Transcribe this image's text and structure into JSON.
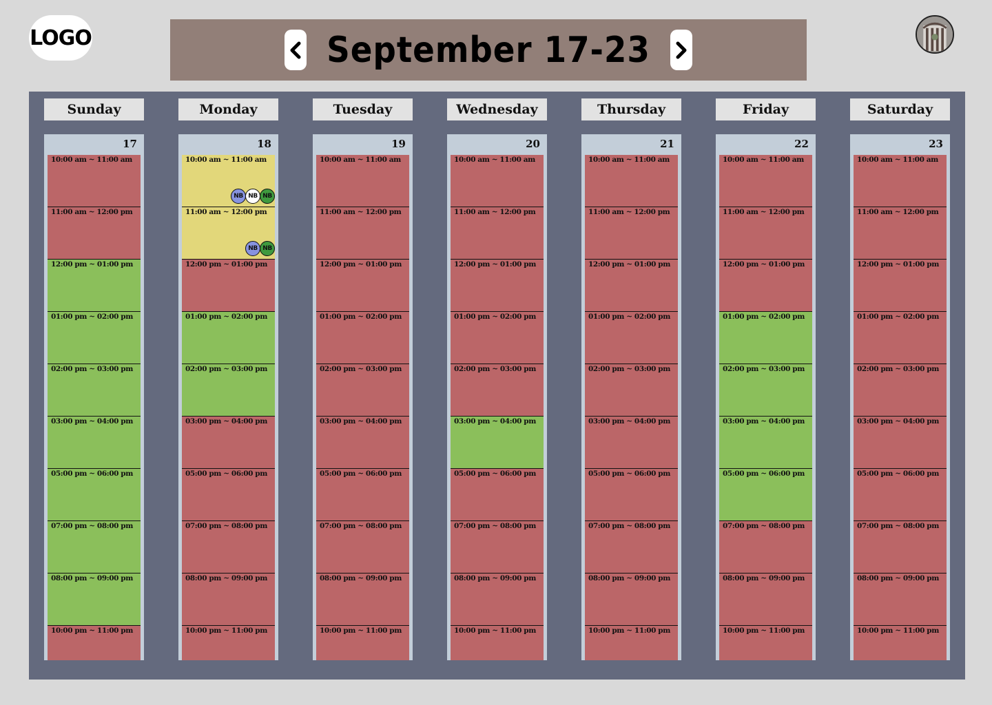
{
  "logo": {
    "text": "LOGO"
  },
  "header": {
    "title": "September 17-23",
    "prev_icon": "chevron-left-icon",
    "next_icon": "chevron-right-icon"
  },
  "avatar": {
    "icon": "user-avatar"
  },
  "colors": {
    "unavailable": "#bb6668",
    "available": "#8bbf5b",
    "booked": "#e2d77a",
    "board": "#646a7e",
    "header_bg": "#927f78"
  },
  "days": [
    {
      "name": "Sunday",
      "date": "17",
      "slots": [
        {
          "time": "10:00 am ~ 11:00 am",
          "status": "unavailable"
        },
        {
          "time": "11:00 am ~ 12:00 pm",
          "status": "unavailable"
        },
        {
          "time": "12:00 pm ~ 01:00 pm",
          "status": "available"
        },
        {
          "time": "01:00 pm ~ 02:00 pm",
          "status": "available"
        },
        {
          "time": "02:00 pm ~ 03:00 pm",
          "status": "available"
        },
        {
          "time": "03:00 pm ~ 04:00 pm",
          "status": "available"
        },
        {
          "time": "05:00 pm ~ 06:00 pm",
          "status": "available"
        },
        {
          "time": "07:00 pm ~ 08:00 pm",
          "status": "available"
        },
        {
          "time": "08:00 pm ~ 09:00 pm",
          "status": "available"
        },
        {
          "time": "10:00 pm ~ 11:00 pm",
          "status": "unavailable"
        }
      ]
    },
    {
      "name": "Monday",
      "date": "18",
      "slots": [
        {
          "time": "10:00 am ~ 11:00 am",
          "status": "booked",
          "badges": [
            {
              "label": "NB",
              "color": "#8793e0"
            },
            {
              "label": "NB",
              "color": "#ffffff"
            },
            {
              "label": "NB",
              "color": "#3f9a3e"
            }
          ]
        },
        {
          "time": "11:00 am ~ 12:00 pm",
          "status": "booked",
          "badges": [
            {
              "label": "NB",
              "color": "#8793e0"
            },
            {
              "label": "NB",
              "color": "#3f9a3e"
            }
          ]
        },
        {
          "time": "12:00 pm ~ 01:00 pm",
          "status": "unavailable"
        },
        {
          "time": "01:00 pm ~ 02:00 pm",
          "status": "available"
        },
        {
          "time": "02:00 pm ~ 03:00 pm",
          "status": "available"
        },
        {
          "time": "03:00 pm ~ 04:00 pm",
          "status": "unavailable"
        },
        {
          "time": "05:00 pm ~ 06:00 pm",
          "status": "unavailable"
        },
        {
          "time": "07:00 pm ~ 08:00 pm",
          "status": "unavailable"
        },
        {
          "time": "08:00 pm ~ 09:00 pm",
          "status": "unavailable"
        },
        {
          "time": "10:00 pm ~ 11:00 pm",
          "status": "unavailable"
        }
      ]
    },
    {
      "name": "Tuesday",
      "date": "19",
      "slots": [
        {
          "time": "10:00 am ~ 11:00 am",
          "status": "unavailable"
        },
        {
          "time": "11:00 am ~ 12:00 pm",
          "status": "unavailable"
        },
        {
          "time": "12:00 pm ~ 01:00 pm",
          "status": "unavailable"
        },
        {
          "time": "01:00 pm ~ 02:00 pm",
          "status": "unavailable"
        },
        {
          "time": "02:00 pm ~ 03:00 pm",
          "status": "unavailable"
        },
        {
          "time": "03:00 pm ~ 04:00 pm",
          "status": "unavailable"
        },
        {
          "time": "05:00 pm ~ 06:00 pm",
          "status": "unavailable"
        },
        {
          "time": "07:00 pm ~ 08:00 pm",
          "status": "unavailable"
        },
        {
          "time": "08:00 pm ~ 09:00 pm",
          "status": "unavailable"
        },
        {
          "time": "10:00 pm ~ 11:00 pm",
          "status": "unavailable"
        }
      ]
    },
    {
      "name": "Wednesday",
      "date": "20",
      "slots": [
        {
          "time": "10:00 am ~ 11:00 am",
          "status": "unavailable"
        },
        {
          "time": "11:00 am ~ 12:00 pm",
          "status": "unavailable"
        },
        {
          "time": "12:00 pm ~ 01:00 pm",
          "status": "unavailable"
        },
        {
          "time": "01:00 pm ~ 02:00 pm",
          "status": "unavailable"
        },
        {
          "time": "02:00 pm ~ 03:00 pm",
          "status": "unavailable"
        },
        {
          "time": "03:00 pm ~ 04:00 pm",
          "status": "available"
        },
        {
          "time": "05:00 pm ~ 06:00 pm",
          "status": "unavailable"
        },
        {
          "time": "07:00 pm ~ 08:00 pm",
          "status": "unavailable"
        },
        {
          "time": "08:00 pm ~ 09:00 pm",
          "status": "unavailable"
        },
        {
          "time": "10:00 pm ~ 11:00 pm",
          "status": "unavailable"
        }
      ]
    },
    {
      "name": "Thursday",
      "date": "21",
      "slots": [
        {
          "time": "10:00 am ~ 11:00 am",
          "status": "unavailable"
        },
        {
          "time": "11:00 am ~ 12:00 pm",
          "status": "unavailable"
        },
        {
          "time": "12:00 pm ~ 01:00 pm",
          "status": "unavailable"
        },
        {
          "time": "01:00 pm ~ 02:00 pm",
          "status": "unavailable"
        },
        {
          "time": "02:00 pm ~ 03:00 pm",
          "status": "unavailable"
        },
        {
          "time": "03:00 pm ~ 04:00 pm",
          "status": "unavailable"
        },
        {
          "time": "05:00 pm ~ 06:00 pm",
          "status": "unavailable"
        },
        {
          "time": "07:00 pm ~ 08:00 pm",
          "status": "unavailable"
        },
        {
          "time": "08:00 pm ~ 09:00 pm",
          "status": "unavailable"
        },
        {
          "time": "10:00 pm ~ 11:00 pm",
          "status": "unavailable"
        }
      ]
    },
    {
      "name": "Friday",
      "date": "22",
      "slots": [
        {
          "time": "10:00 am ~ 11:00 am",
          "status": "unavailable"
        },
        {
          "time": "11:00 am ~ 12:00 pm",
          "status": "unavailable"
        },
        {
          "time": "12:00 pm ~ 01:00 pm",
          "status": "unavailable"
        },
        {
          "time": "01:00 pm ~ 02:00 pm",
          "status": "available"
        },
        {
          "time": "02:00 pm ~ 03:00 pm",
          "status": "available"
        },
        {
          "time": "03:00 pm ~ 04:00 pm",
          "status": "available"
        },
        {
          "time": "05:00 pm ~ 06:00 pm",
          "status": "available"
        },
        {
          "time": "07:00 pm ~ 08:00 pm",
          "status": "unavailable"
        },
        {
          "time": "08:00 pm ~ 09:00 pm",
          "status": "unavailable"
        },
        {
          "time": "10:00 pm ~ 11:00 pm",
          "status": "unavailable"
        }
      ]
    },
    {
      "name": "Saturday",
      "date": "23",
      "slots": [
        {
          "time": "10:00 am ~ 11:00 am",
          "status": "unavailable"
        },
        {
          "time": "11:00 am ~ 12:00 pm",
          "status": "unavailable"
        },
        {
          "time": "12:00 pm ~ 01:00 pm",
          "status": "unavailable"
        },
        {
          "time": "01:00 pm ~ 02:00 pm",
          "status": "unavailable"
        },
        {
          "time": "02:00 pm ~ 03:00 pm",
          "status": "unavailable"
        },
        {
          "time": "03:00 pm ~ 04:00 pm",
          "status": "unavailable"
        },
        {
          "time": "05:00 pm ~ 06:00 pm",
          "status": "unavailable"
        },
        {
          "time": "07:00 pm ~ 08:00 pm",
          "status": "unavailable"
        },
        {
          "time": "08:00 pm ~ 09:00 pm",
          "status": "unavailable"
        },
        {
          "time": "10:00 pm ~ 11:00 pm",
          "status": "unavailable"
        }
      ]
    }
  ]
}
